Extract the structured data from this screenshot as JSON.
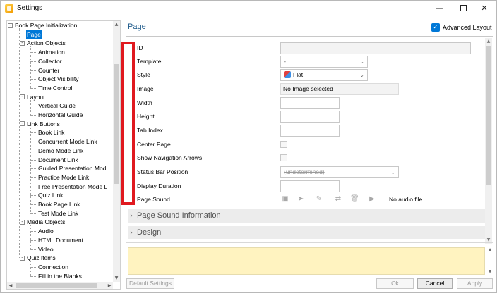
{
  "window": {
    "title": "Settings"
  },
  "tree": {
    "items": [
      {
        "label": "Book Page Initialization",
        "level": 0,
        "expander": "minus"
      },
      {
        "label": "Page",
        "level": 1,
        "selected": true
      },
      {
        "label": "Action Objects",
        "level": 1,
        "expander": "minus"
      },
      {
        "label": "Animation",
        "level": 2
      },
      {
        "label": "Collector",
        "level": 2
      },
      {
        "label": "Counter",
        "level": 2
      },
      {
        "label": "Object Visibility",
        "level": 2
      },
      {
        "label": "Time Control",
        "level": 2
      },
      {
        "label": "Layout",
        "level": 1,
        "expander": "minus"
      },
      {
        "label": "Vertical Guide",
        "level": 2
      },
      {
        "label": "Horizontal Guide",
        "level": 2
      },
      {
        "label": "Link Buttons",
        "level": 1,
        "expander": "minus"
      },
      {
        "label": "Book Link",
        "level": 2
      },
      {
        "label": "Concurrent Mode Link",
        "level": 2
      },
      {
        "label": "Demo Mode Link",
        "level": 2
      },
      {
        "label": "Document Link",
        "level": 2
      },
      {
        "label": "Guided Presentation Mod",
        "level": 2
      },
      {
        "label": "Practice Mode Link",
        "level": 2
      },
      {
        "label": "Free Presentation Mode L",
        "level": 2
      },
      {
        "label": "Quiz Link",
        "level": 2
      },
      {
        "label": "Book Page Link",
        "level": 2
      },
      {
        "label": "Test Mode Link",
        "level": 2
      },
      {
        "label": "Media Objects",
        "level": 1,
        "expander": "minus"
      },
      {
        "label": "Audio",
        "level": 2
      },
      {
        "label": "HTML Document",
        "level": 2
      },
      {
        "label": "Video",
        "level": 2
      },
      {
        "label": "Quiz Items",
        "level": 1,
        "expander": "minus"
      },
      {
        "label": "Connection",
        "level": 2
      },
      {
        "label": "Fill in the Blanks",
        "level": 2
      }
    ]
  },
  "header": {
    "page_title": "Page",
    "advanced_layout_label": "Advanced Layout",
    "advanced_layout_checked": true
  },
  "properties": {
    "id_label": "ID",
    "id_value": "",
    "template_label": "Template",
    "template_value": "-",
    "style_label": "Style",
    "style_value": "Flat",
    "image_label": "Image",
    "image_value": "No Image selected",
    "width_label": "Width",
    "width_value": "",
    "height_label": "Height",
    "height_value": "",
    "tab_index_label": "Tab Index",
    "tab_index_value": "",
    "center_page_label": "Center Page",
    "show_nav_arrows_label": "Show Navigation Arrows",
    "status_bar_label": "Status Bar Position",
    "status_bar_value": "(undetermined)",
    "display_duration_label": "Display Duration",
    "display_duration_value": "",
    "page_sound_label": "Page Sound",
    "no_audio_label": "No audio file"
  },
  "sections": {
    "page_sound_info": "Page Sound Information",
    "design": "Design"
  },
  "buttons": {
    "default_settings": "Default Settings",
    "ok": "Ok",
    "cancel": "Cancel",
    "apply": "Apply"
  },
  "colors": {
    "accent": "#0078d7",
    "highlight_frame": "#e0191f",
    "info_panel": "#fff3c0",
    "heading": "#1e5a8a"
  }
}
